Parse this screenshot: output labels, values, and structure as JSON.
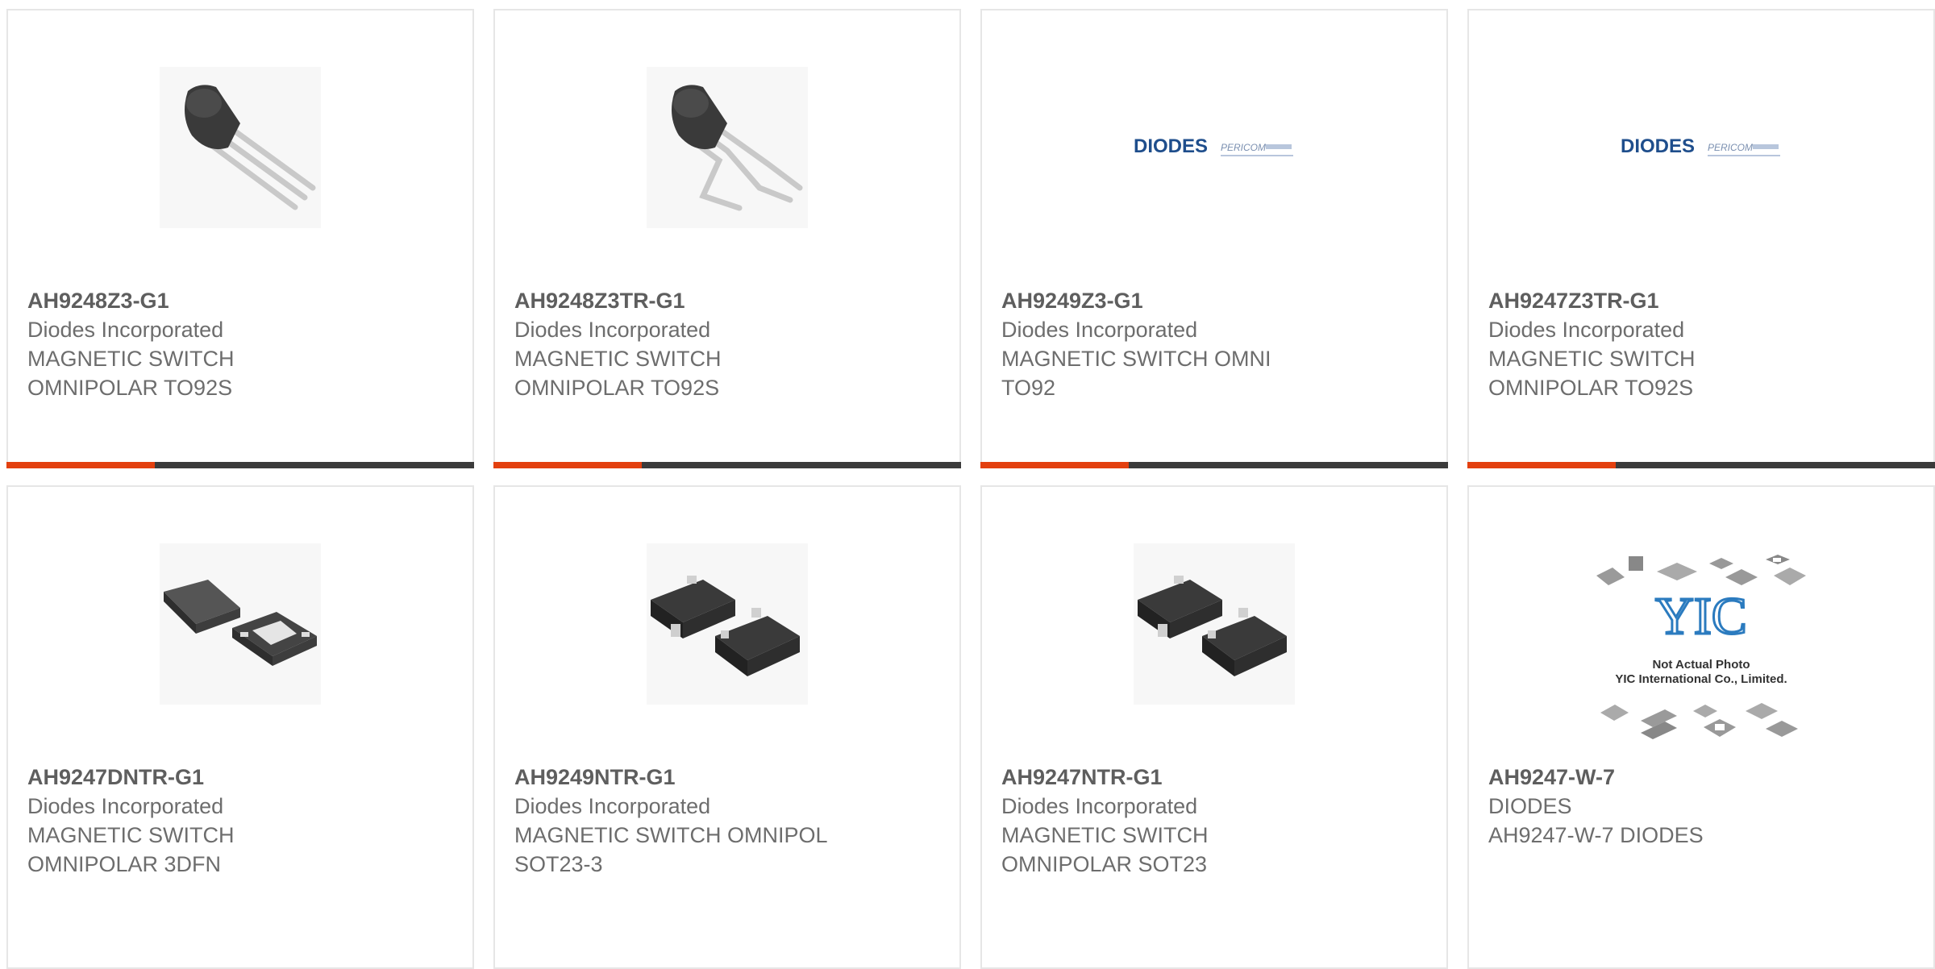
{
  "products": [
    {
      "part": "AH9248Z3-G1",
      "manufacturer": "Diodes Incorporated",
      "description": "MAGNETIC SWITCH\nOMNIPOLAR TO92S",
      "image": "to92-straight-leads"
    },
    {
      "part": "AH9248Z3TR-G1",
      "manufacturer": "Diodes Incorporated",
      "description": "MAGNETIC SWITCH\nOMNIPOLAR TO92S",
      "image": "to92-bent-leads"
    },
    {
      "part": "AH9249Z3-G1",
      "manufacturer": "Diodes Incorporated",
      "description": "MAGNETIC SWITCH OMNI\nTO92",
      "image": "diodes-pericom-logo"
    },
    {
      "part": "AH9247Z3TR-G1",
      "manufacturer": "Diodes Incorporated",
      "description": "MAGNETIC SWITCH\nOMNIPOLAR TO92S",
      "image": "diodes-pericom-logo"
    },
    {
      "part": "AH9247DNTR-G1",
      "manufacturer": "Diodes Incorporated",
      "description": "MAGNETIC SWITCH\nOMNIPOLAR 3DFN",
      "image": "dfn-package"
    },
    {
      "part": "AH9249NTR-G1",
      "manufacturer": "Diodes Incorporated",
      "description": "MAGNETIC SWITCH OMNIPOL\nSOT23-3",
      "image": "sot23-package"
    },
    {
      "part": "AH9247NTR-G1",
      "manufacturer": "Diodes Incorporated",
      "description": "MAGNETIC SWITCH\nOMNIPOLAR SOT23",
      "image": "sot23-package"
    },
    {
      "part": "AH9247-W-7",
      "manufacturer": "DIODES",
      "description": "AH9247-W-7 DIODES",
      "image": "yic-not-actual-photo"
    }
  ],
  "logo_text": {
    "diodes": "DIODES",
    "pericom": "PERICOM",
    "yic": "YIC",
    "yic_line1": "Not Actual Photo",
    "yic_line2": "YIC International Co., Limited."
  },
  "colors": {
    "accent": "#e3400f",
    "bar": "#3b3b3b",
    "diodes_blue": "#1f4e8c"
  }
}
